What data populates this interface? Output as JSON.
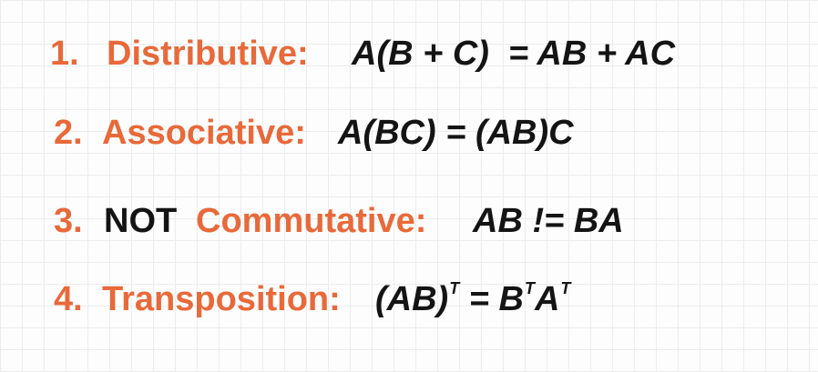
{
  "properties": [
    {
      "number": "1.",
      "term": "Distributive:",
      "formula": "A(B + C)  = AB + AC"
    },
    {
      "number": "2.",
      "term": "Associative:",
      "formula": "A(BC) = (AB)C"
    },
    {
      "number": "3.",
      "prefix": "NOT",
      "term": "Commutative:",
      "formula": "AB != BA"
    },
    {
      "number": "4.",
      "term": "Transposition:",
      "formula_parts": {
        "lhs": "(AB)",
        "lhs_sup": "T",
        "eq": " = B",
        "b_sup": "T",
        "a": "A",
        "a_sup": "T"
      }
    }
  ],
  "colors": {
    "accent": "#e8693a",
    "text": "#141414",
    "grid": "#ececec",
    "background": "#fdfdfd"
  }
}
